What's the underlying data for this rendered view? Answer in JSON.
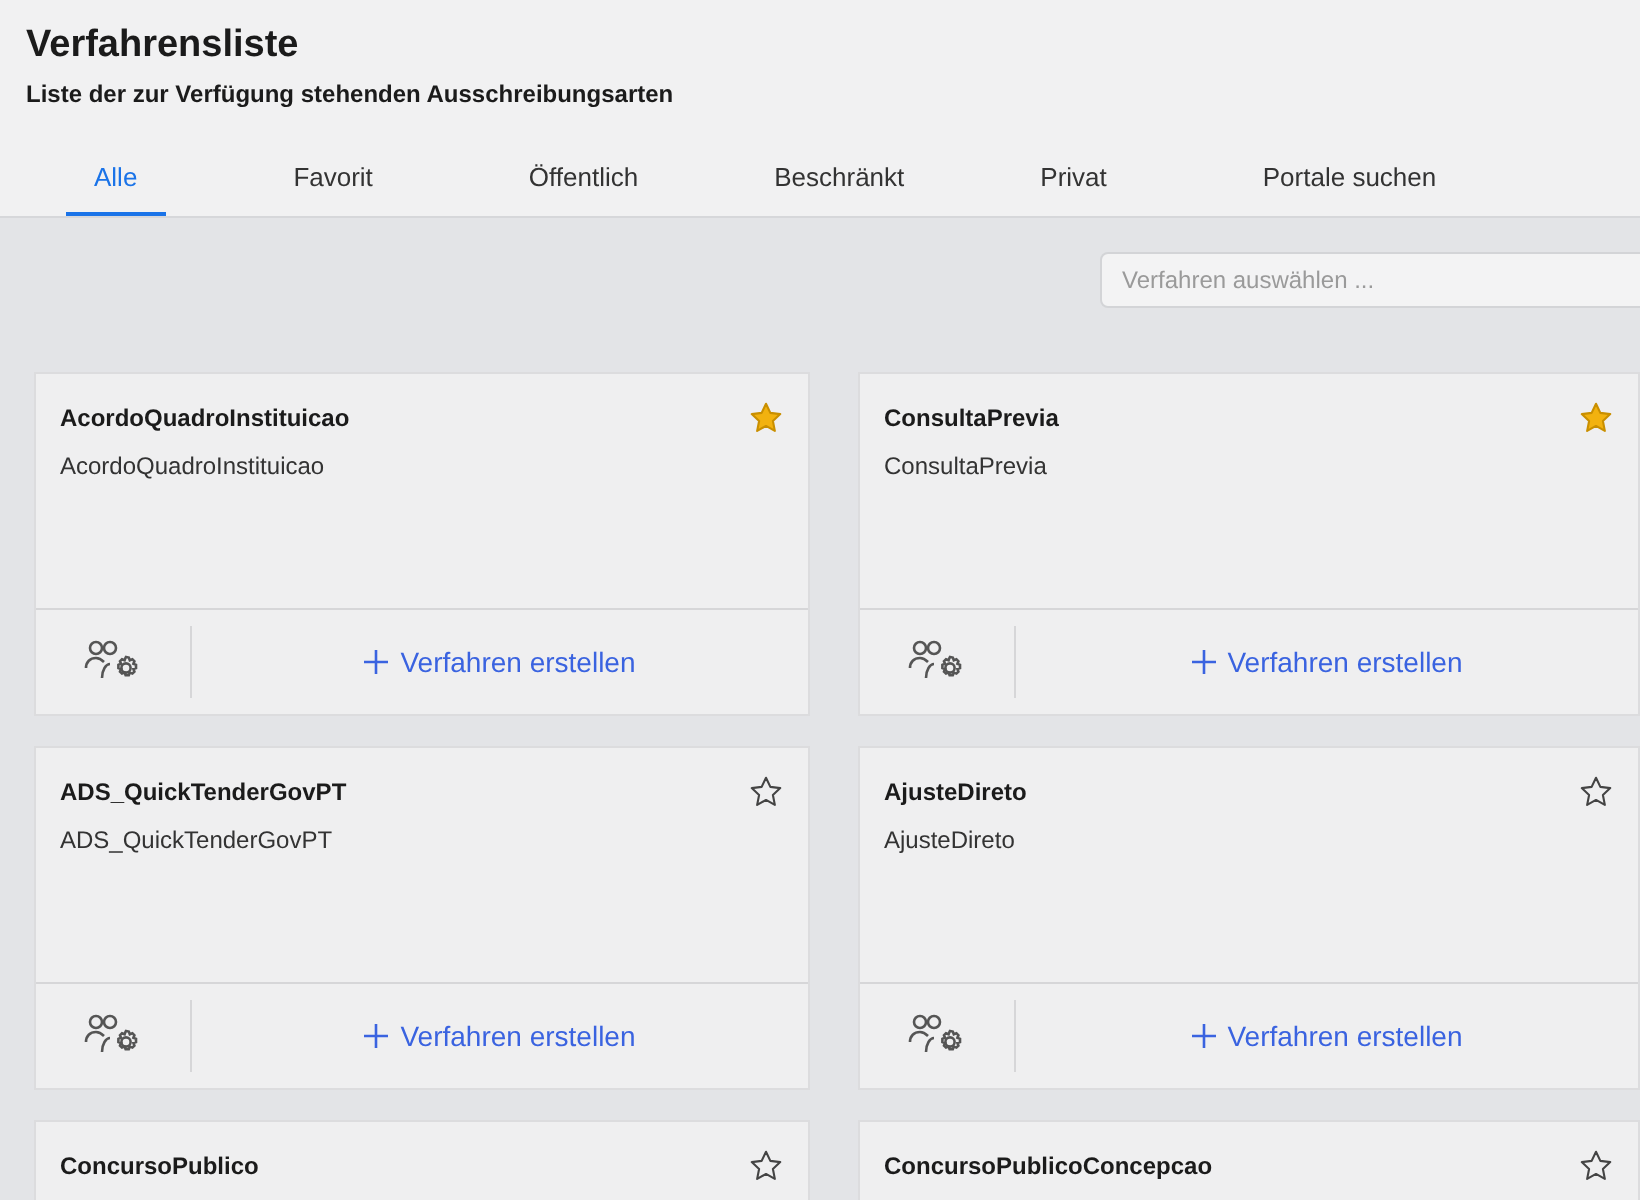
{
  "header": {
    "title": "Verfahrensliste",
    "subtitle": "Liste der zur Verfügung stehenden Ausschreibungsarten"
  },
  "tabs": [
    {
      "label": "Alle",
      "selected": true
    },
    {
      "label": "Favorit",
      "selected": false
    },
    {
      "label": "Öffentlich",
      "selected": false
    },
    {
      "label": "Beschränkt",
      "selected": false
    },
    {
      "label": "Privat",
      "selected": false
    },
    {
      "label": "Portale suchen",
      "selected": false
    }
  ],
  "search": {
    "placeholder": "Verfahren auswählen ..."
  },
  "cards": [
    {
      "title": "AcordoQuadroInstituicao",
      "description": "AcordoQuadroInstituicao",
      "favorite": true,
      "action": "Verfahren erstellen"
    },
    {
      "title": "ConsultaPrevia",
      "description": "ConsultaPrevia",
      "favorite": true,
      "action": "Verfahren erstellen"
    },
    {
      "title": "ADS_QuickTenderGovPT",
      "description": "ADS_QuickTenderGovPT",
      "favorite": false,
      "action": "Verfahren erstellen"
    },
    {
      "title": "AjusteDireto",
      "description": "AjusteDireto",
      "favorite": false,
      "action": "Verfahren erstellen"
    },
    {
      "title": "ConcursoPublico",
      "favorite": false
    },
    {
      "title": "ConcursoPublicoConcepcao",
      "favorite": false
    }
  ]
}
